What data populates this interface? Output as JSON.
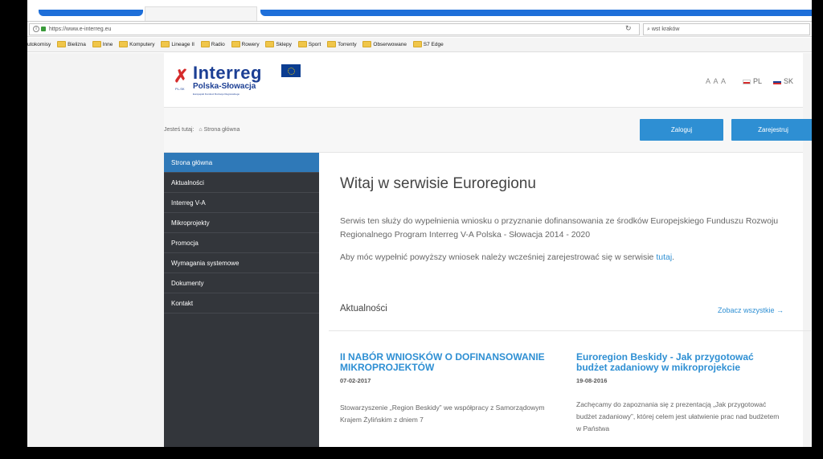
{
  "browser": {
    "url": "https://www.e-interreg.eu",
    "search_value": "wst kraków",
    "reload_icon": "reload-icon",
    "bookmarks": [
      "utokomisy",
      "Bielizna",
      "Inne",
      "Komputery",
      "Lineage II",
      "Radio",
      "Rowery",
      "Sklepy",
      "Sport",
      "Torrenty",
      "Obserwowane",
      "S7 Edge"
    ]
  },
  "header": {
    "brand": "Interreg",
    "subbrand": "Polska-Słowacja",
    "tagline": "Europejski Fundusz Rozwoju Regionalnego",
    "pl_sk": "PL-SK",
    "font_sizes": "A A A",
    "lang_pl": "PL",
    "lang_sk": "SK"
  },
  "breadcrumb": {
    "prefix": "Jesteś tutaj:",
    "current": "Strona główna"
  },
  "auth": {
    "login": "Zaloguj",
    "register": "Zarejestruj"
  },
  "sidebar": {
    "items": [
      {
        "label": "Strona główna"
      },
      {
        "label": "Aktualności"
      },
      {
        "label": "Interreg V-A"
      },
      {
        "label": "Mikroprojekty"
      },
      {
        "label": "Promocja"
      },
      {
        "label": "Wymagania systemowe"
      },
      {
        "label": "Dokumenty"
      },
      {
        "label": "Kontakt"
      }
    ]
  },
  "main": {
    "title": "Witaj w serwisie Euroregionu",
    "intro": "Serwis ten służy do wypełnienia wniosku o przyznanie dofinansowania ze środków Europejskiego Funduszu Rozwoju Regionalnego Program Interreg V-A Polska - Słowacja 2014 - 2020",
    "intro2_text": "Aby móc wypełnić powyższy wniosek należy wcześniej zarejestrować się w serwisie ",
    "intro2_link": "tutaj",
    "intro2_end": ".",
    "news_heading": "Aktualności",
    "see_all": "Zobacz wszystkie →",
    "news": [
      {
        "title": "II NABÓR WNIOSKÓW O DOFINANSOWANIE MIKROPROJEKTÓW",
        "date": "07-02-2017",
        "body": "Stowarzyszenie „Region Beskidy” we współpracy z Samorządowym Krajem Żylińskim z dniem 7"
      },
      {
        "title": "Euroregion Beskidy - Jak przygotować budżet zadaniowy w mikroprojekcie",
        "date": "19-08-2016",
        "body": "Zachęcamy do zapoznania się z prezentacją „Jak przygotować budżet zadaniowy”, której celem jest ułatwienie prac nad budżetem w Państwa"
      }
    ]
  },
  "colors": {
    "accent": "#2e8fd3",
    "sidebar_bg": "#33363b",
    "sidebar_active": "#2f79b8",
    "brand_blue": "#1c3f94"
  }
}
